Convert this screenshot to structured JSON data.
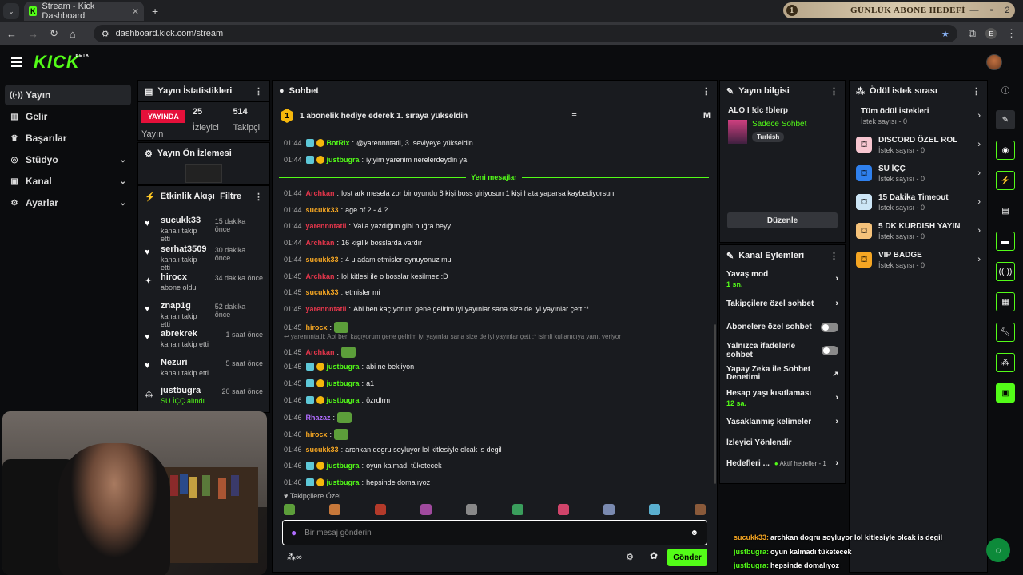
{
  "browser": {
    "tab_title": "Stream - Kick Dashboard",
    "url": "dashboard.kick.com/stream",
    "profile_initial": "E"
  },
  "goal": {
    "number": "1",
    "title": "GÜNLÜK ABONE HEDEFİ",
    "count": "2"
  },
  "app": {
    "logo": "KICK",
    "logo_sup": "BETA"
  },
  "nav": [
    {
      "label": "Yayın",
      "icon": "broadcast-icon"
    },
    {
      "label": "Gelir",
      "icon": "revenue-icon"
    },
    {
      "label": "Başarılar",
      "icon": "trophy-icon"
    },
    {
      "label": "Stüdyo",
      "icon": "studio-icon"
    },
    {
      "label": "Kanal",
      "icon": "channel-icon"
    },
    {
      "label": "Ayarlar",
      "icon": "gear-icon"
    }
  ],
  "stats": {
    "title": "Yayın İstatistikleri",
    "live": "YAYINDA",
    "live_label": "Yayın",
    "viewers": "25",
    "viewers_label": "İzleyici",
    "followers": "514",
    "followers_label": "Takipçi"
  },
  "preview": {
    "title": "Yayın Ön İzlemesi"
  },
  "activity": {
    "title": "Etkinlik Akışı",
    "filter": "Filtre",
    "items": [
      {
        "name": "sucukk33",
        "sub": "kanalı takip etti",
        "time": "15 dakika önce",
        "icon": "heart-icon"
      },
      {
        "name": "serhat3509",
        "sub": "kanalı takip etti",
        "time": "30 dakika önce",
        "icon": "heart-icon"
      },
      {
        "name": "hirocx",
        "sub": "abone oldu",
        "time": "34 dakika önce",
        "icon": "sparkle-icon"
      },
      {
        "name": "znap1g",
        "sub": "kanalı takip etti",
        "time": "52 dakika önce",
        "icon": "heart-icon"
      },
      {
        "name": "abrekrek",
        "sub": "kanalı takip etti",
        "time": "1 saat önce",
        "icon": "heart-icon"
      },
      {
        "name": "Nezuri",
        "sub": "kanalı takip etti",
        "time": "5 saat önce",
        "icon": "heart-icon"
      },
      {
        "name": "justbugra",
        "sub": "SU İÇÇ alındı",
        "time": "20 saat önce",
        "icon": "reward-icon"
      }
    ]
  },
  "chat": {
    "title": "Sohbet",
    "pinned": "1 abonelik hediye ederek 1. sıraya yükseldin",
    "pinned_badge": "1",
    "pinned_trail": "M",
    "new_messages": "Yeni mesajlar",
    "followers_only": "Takipçilere Özel",
    "input_placeholder": "Bir mesaj gönderin",
    "send": "Gönder",
    "reply_context": "yarennntatli: Abi ben kaçıyorum gene gelirim iyi yayınlar sana size de iyi yayınlar çett :* isimli kullanıcıya yanıt veriyor",
    "messages": [
      {
        "time": "01:44",
        "user": "BotRix",
        "color": "green",
        "text": "@yarennntatli, 3. seviyeye yükseldin"
      },
      {
        "time": "01:44",
        "user": "justbugra",
        "color": "green",
        "text": "iyiyim yarenim nerelerdeydin ya"
      },
      {
        "time": "01:44",
        "user": "Archkan",
        "color": "red",
        "text": "lost ark mesela zor bir oyundu 8 kişi boss giriyosun 1 kişi hata yaparsa kaybediyorsun"
      },
      {
        "time": "01:44",
        "user": "sucukk33",
        "color": "orange",
        "text": "age of 2 - 4 ?"
      },
      {
        "time": "01:44",
        "user": "yarennntatli",
        "color": "red",
        "text": "Valla yazdığım gibi buğra beyy"
      },
      {
        "time": "01:44",
        "user": "Archkan",
        "color": "red",
        "text": "16 kişilik bosslarda vardır"
      },
      {
        "time": "01:44",
        "user": "sucukk33",
        "color": "orange",
        "text": "4 u adam etmisler oynuyonuz mu"
      },
      {
        "time": "01:45",
        "user": "Archkan",
        "color": "red",
        "text": "lol kitlesi ile o bosslar kesilmez :D"
      },
      {
        "time": "01:45",
        "user": "sucukk33",
        "color": "orange",
        "text": "etmisler mi"
      },
      {
        "time": "01:45",
        "user": "yarennntatli",
        "color": "red",
        "text": "Abi ben kaçıyorum gene gelirim iyi yayınlar sana size de iyi yayınlar çett :*"
      },
      {
        "time": "01:45",
        "user": "hirocx",
        "color": "orange",
        "text": ""
      },
      {
        "time": "01:45",
        "user": "Archkan",
        "color": "red",
        "text": ""
      },
      {
        "time": "01:45",
        "user": "justbugra",
        "color": "green",
        "text": "abi ne bekliyon"
      },
      {
        "time": "01:45",
        "user": "justbugra",
        "color": "green",
        "text": "a1"
      },
      {
        "time": "01:46",
        "user": "justbugra",
        "color": "green",
        "text": "özrdlrm"
      },
      {
        "time": "01:46",
        "user": "Rhazaz",
        "color": "purple",
        "text": ""
      },
      {
        "time": "01:46",
        "user": "hirocx",
        "color": "orange",
        "text": ""
      },
      {
        "time": "01:46",
        "user": "sucukk33",
        "color": "orange",
        "text": "archkan dogru soyluyor lol kitlesiyle olcak is degil"
      },
      {
        "time": "01:46",
        "user": "justbugra",
        "color": "green",
        "text": "oyun kalmadı tüketecek"
      },
      {
        "time": "01:46",
        "user": "justbugra",
        "color": "green",
        "text": "hepsinde domalıyoz"
      }
    ]
  },
  "stream_info": {
    "title": "Yayın bilgisi",
    "stream_title": "ALO I !dc !blerp",
    "category": "Sadece Sohbet",
    "tag": "Turkish",
    "edit": "Düzenle"
  },
  "channel_actions": {
    "title": "Kanal Eylemleri",
    "items": [
      {
        "label": "Yavaş mod",
        "sub": "1 sn.",
        "kind": "chevron"
      },
      {
        "label": "Takipçilere özel sohbet",
        "kind": "chevron"
      },
      {
        "label": "Abonelere özel sohbet",
        "kind": "toggle"
      },
      {
        "label": "Yalnızca ifadelerle sohbet",
        "kind": "toggle"
      },
      {
        "label": "Yapay Zeka ile Sohbet Denetimi",
        "kind": "external"
      },
      {
        "label": "Hesap yaşı kısıtlaması",
        "sub": "12 sa.",
        "kind": "chevron"
      },
      {
        "label": "Yasaklanmış kelimeler",
        "kind": "chevron"
      },
      {
        "label": "İzleyici Yönlendir",
        "kind": "none"
      },
      {
        "label": "Hedefleri ...",
        "extra": "Aktif hedefler - 1",
        "kind": "chevron"
      }
    ]
  },
  "rewards": {
    "title": "Ödül istek sırası",
    "items": [
      {
        "name": "Tüm ödül istekleri",
        "sub": "İstek sayısı - 0",
        "color": ""
      },
      {
        "name": "DISCORD ÖZEL ROL",
        "sub": "İstek sayısı - 0",
        "color": "#f7c6d0"
      },
      {
        "name": "SU İÇÇ",
        "sub": "İstek sayısı - 0",
        "color": "#2f80ed"
      },
      {
        "name": "15 Dakika Timeout",
        "sub": "İstek sayısı - 0",
        "color": "#cde6f7"
      },
      {
        "name": "5 DK KURDISH YAYIN",
        "sub": "İstek sayısı - 0",
        "color": "#f5c27a"
      },
      {
        "name": "VIP BADGE",
        "sub": "İstek sayısı - 0",
        "color": "#f5a623"
      }
    ]
  },
  "overlay_chat": [
    {
      "user": "sucukk33:",
      "text": "archkan dogru soyluyor lol kitlesiyle olcak is degil",
      "color": "#f5a623"
    },
    {
      "user": "justbugra:",
      "text": "oyun kalmadı tüketecek",
      "color": "#53fc18"
    },
    {
      "user": "justbugra:",
      "text": "hepsinde domalıyoz",
      "color": "#53fc18"
    }
  ]
}
